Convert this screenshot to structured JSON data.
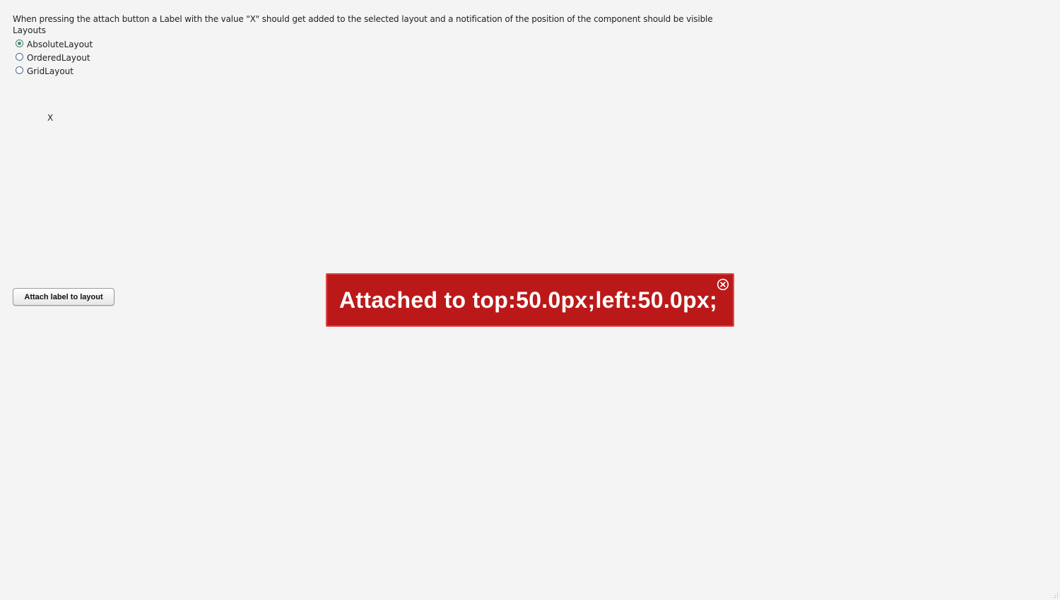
{
  "description": "When pressing the attach button a Label with the value \"X\" should get added to the selected layout and a notification of the position of the component should be visible",
  "layouts": {
    "caption": "Layouts",
    "options": [
      {
        "label": "AbsoluteLayout",
        "selected": true
      },
      {
        "label": "OrderedLayout",
        "selected": false
      },
      {
        "label": "GridLayout",
        "selected": false
      }
    ]
  },
  "attached_label": "X",
  "attach_button_label": "Attach label to layout",
  "notification": {
    "message": "Attached to top:50.0px;left:50.0px;",
    "close_icon": "close-circle-icon",
    "background_color": "#bb1919"
  }
}
